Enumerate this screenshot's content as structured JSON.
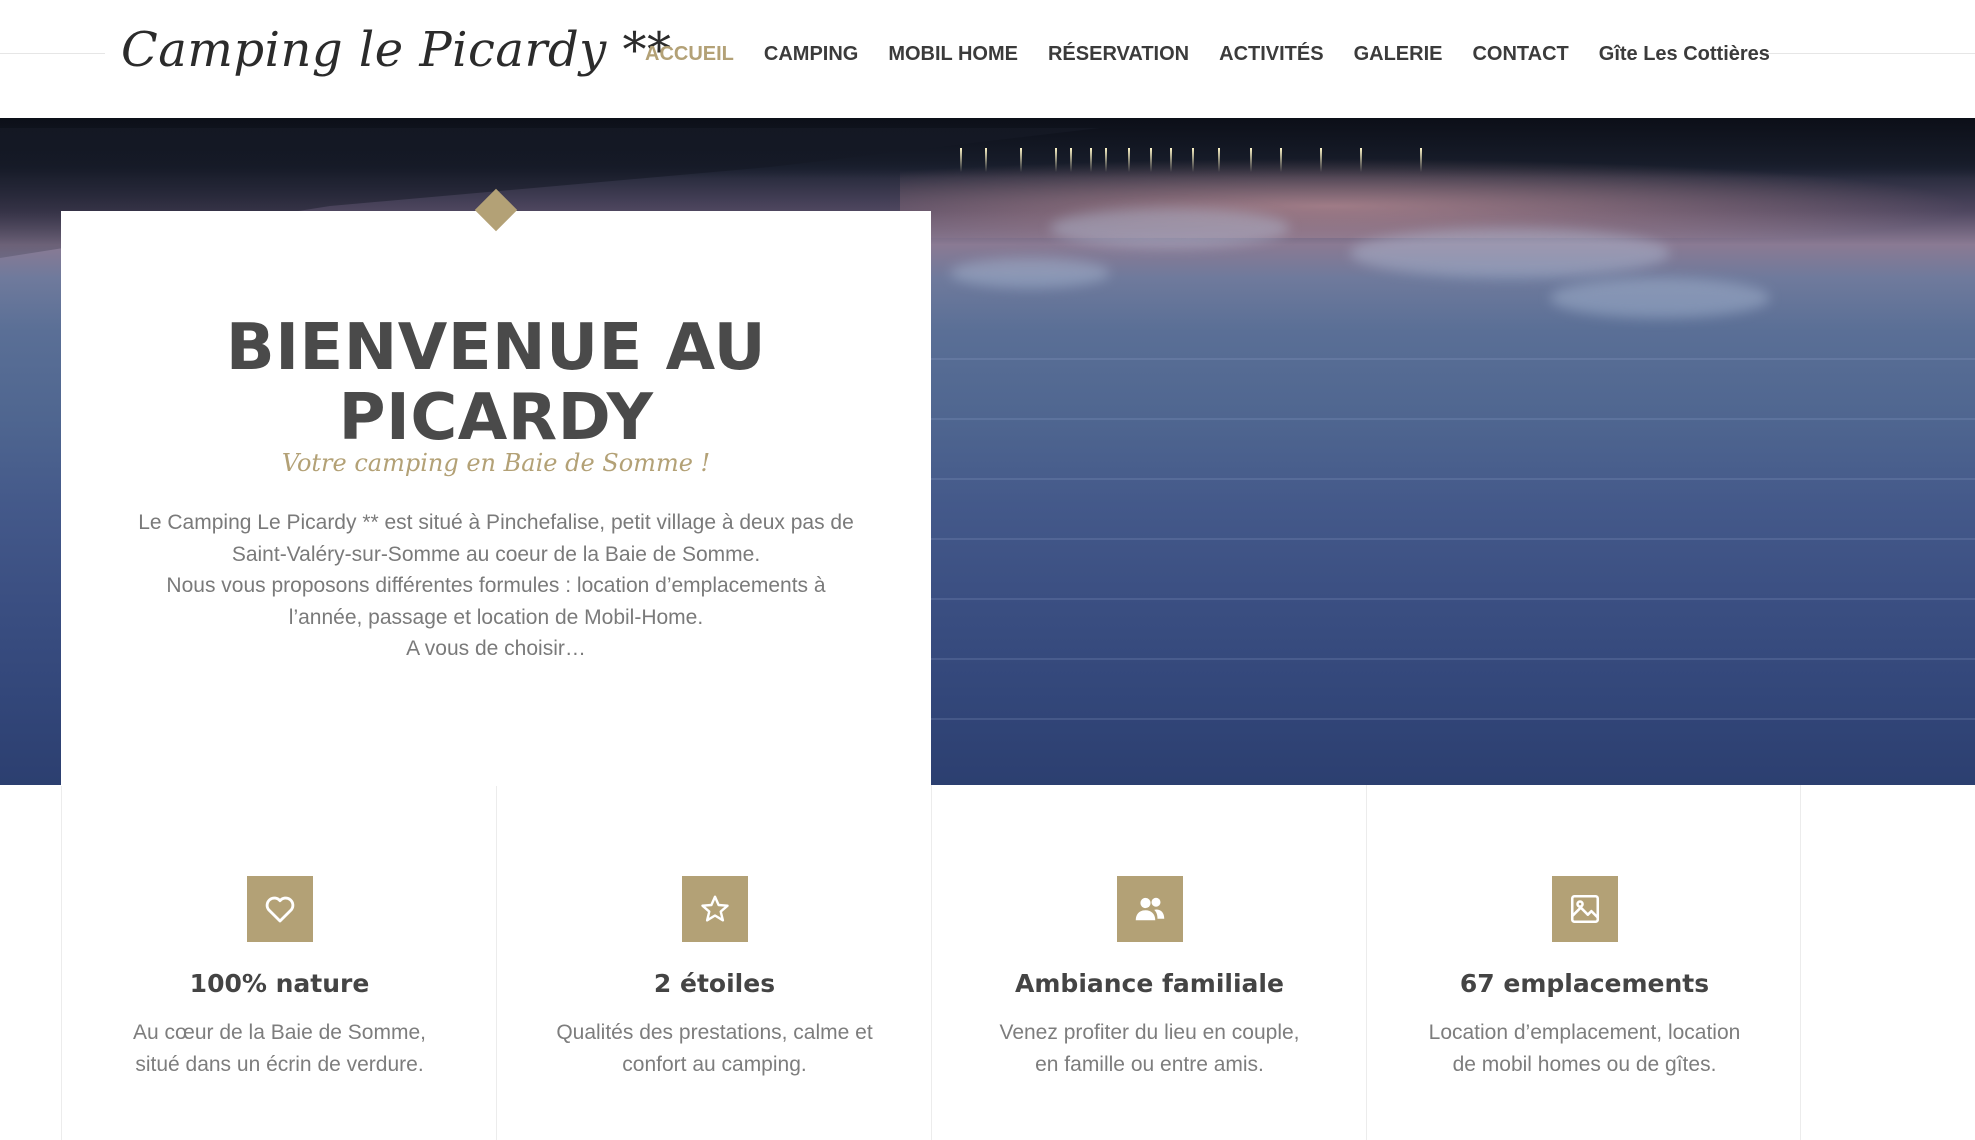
{
  "header": {
    "brand": "Camping le Picardy **",
    "nav": [
      {
        "label": "ACCUEIL",
        "active": true
      },
      {
        "label": "CAMPING",
        "active": false
      },
      {
        "label": "MOBIL HOME",
        "active": false
      },
      {
        "label": "RÉSERVATION",
        "active": false
      },
      {
        "label": "ACTIVITÉS",
        "active": false
      },
      {
        "label": "GALERIE",
        "active": false
      },
      {
        "label": "CONTACT",
        "active": false
      },
      {
        "label": "Gîte Les Cottières",
        "active": false
      }
    ]
  },
  "welcome": {
    "title_line1": "BIENVENUE AU",
    "title_line2": "PICARDY",
    "subtitle": "Votre camping en Baie de Somme !",
    "desc_line1": "Le Camping Le Picardy ** est situé à Pinchefalise, petit village à deux pas de",
    "desc_line2": "Saint-Valéry-sur-Somme au coeur de la Baie de Somme.",
    "desc_line3": "Nous vous proposons différentes formules : location d’emplacements à",
    "desc_line4": "l’année, passage et location de Mobil-Home.",
    "desc_line5": "A vous de choisir…"
  },
  "features": [
    {
      "icon": "heart-icon",
      "title": "100% nature",
      "line1": "Au cœur de la Baie de Somme,",
      "line2": "situé dans un écrin de verdure."
    },
    {
      "icon": "star-icon",
      "title": "2 étoiles",
      "line1": "Qualités des prestations, calme et",
      "line2": "confort au camping."
    },
    {
      "icon": "users-icon",
      "title": "Ambiance familiale",
      "line1": "Venez profiter du lieu en couple,",
      "line2": "en famille ou entre amis."
    },
    {
      "icon": "image-icon",
      "title": "67 emplacements",
      "line1": "Location d’emplacement, location",
      "line2": "de mobil homes ou de gîtes."
    }
  ],
  "colors": {
    "accent": "#b3a176",
    "text_dark": "#4a4a4a",
    "text_muted": "#7a7a7a"
  }
}
